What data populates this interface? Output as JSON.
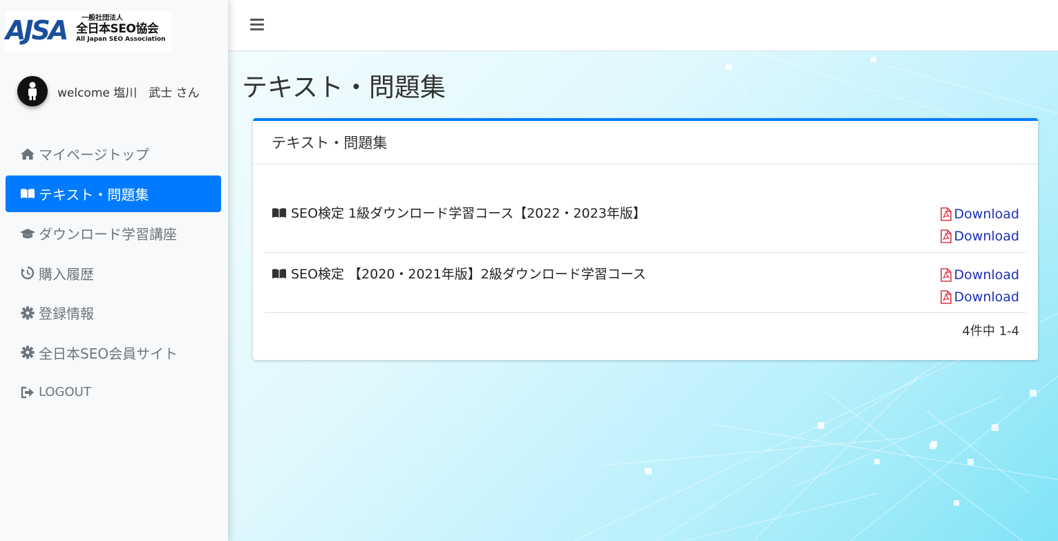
{
  "brand": {
    "logo_mark": "AJSA",
    "org_line1": "一般社団法人",
    "org_line2": "全日本SEO協会",
    "org_line3": "All Japan SEO Association"
  },
  "user": {
    "greeting": "welcome 塩川　武士 さん"
  },
  "sidebar": {
    "items": [
      {
        "label": "マイページトップ",
        "icon": "home-icon"
      },
      {
        "label": "テキスト・問題集",
        "icon": "book-open-icon",
        "active": true
      },
      {
        "label": "ダウンロード学習講座",
        "icon": "graduation-cap-icon"
      },
      {
        "label": "購入履歴",
        "icon": "history-icon"
      },
      {
        "label": "登録情報",
        "icon": "gear-icon"
      },
      {
        "label": "全日本SEO会員サイト",
        "icon": "gear-icon"
      },
      {
        "label": "LOGOUT",
        "icon": "sign-out-icon"
      }
    ]
  },
  "page": {
    "title": "テキスト・問題集"
  },
  "card": {
    "header": "テキスト・問題集",
    "rows": [
      {
        "title": "SEO検定 1級ダウンロード学習コース【2022・2023年版】",
        "downloads": [
          "Download",
          "Download"
        ]
      },
      {
        "title": "SEO検定 【2020・2021年版】2級ダウンロード学習コース",
        "downloads": [
          "Download",
          "Download"
        ]
      }
    ],
    "pagination": "4件中 1-4"
  },
  "colors": {
    "accent": "#007bff",
    "link": "#1a2fb8",
    "pdf": "#dc3545"
  }
}
